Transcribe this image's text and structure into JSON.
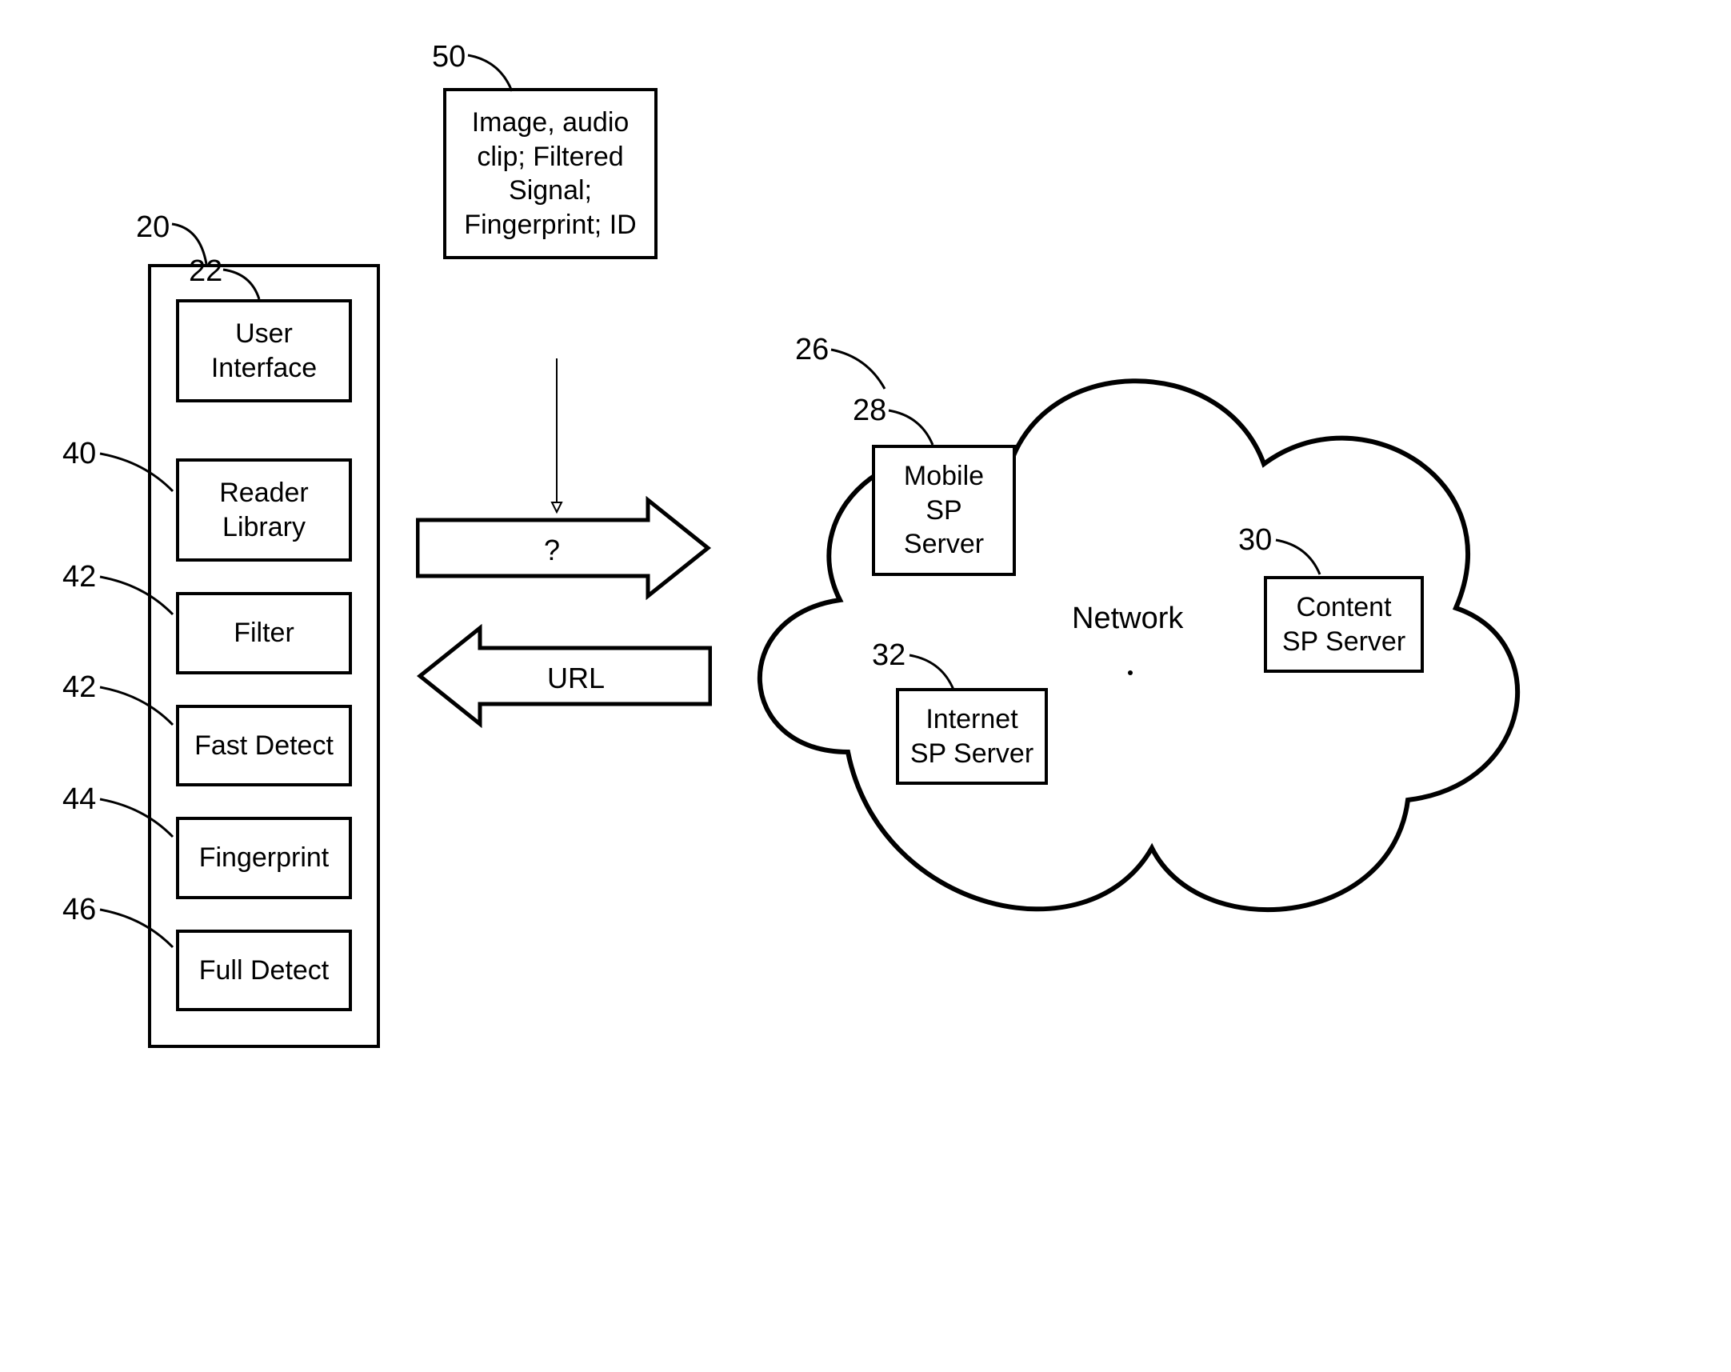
{
  "refs": {
    "r20": "20",
    "r22": "22",
    "r40": "40",
    "r42a": "42",
    "r42b": "42",
    "r44": "44",
    "r46": "46",
    "r50": "50",
    "r26": "26",
    "r28": "28",
    "r30": "30",
    "r32": "32"
  },
  "device": {
    "ui": "User Interface",
    "reader": "Reader Library",
    "filter": "Filter",
    "fastdetect": "Fast Detect",
    "fingerprint": "Fingerprint",
    "fulldetect": "Full Detect"
  },
  "media": {
    "text": "Image, audio clip; Filtered Signal; Fingerprint; ID"
  },
  "arrows": {
    "question": "?",
    "url": "URL"
  },
  "cloud": {
    "network": "Network",
    "mobile": "Mobile SP Server",
    "content": "Content SP Server",
    "internet": "Internet SP Server"
  }
}
